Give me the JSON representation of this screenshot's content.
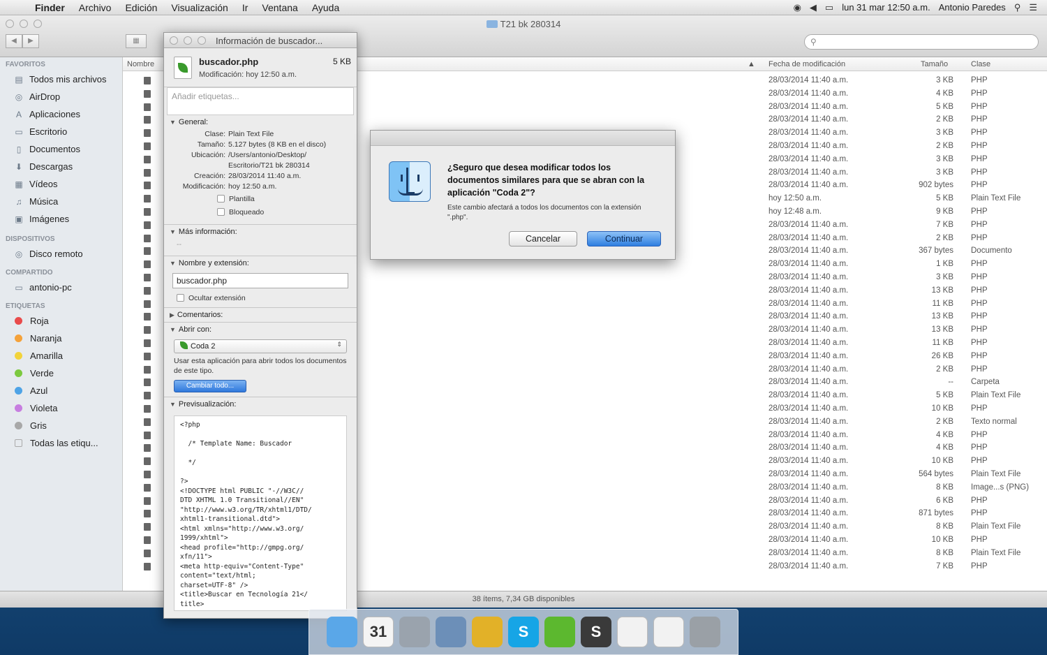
{
  "menubar": {
    "apple": "",
    "menus": [
      "Finder",
      "Archivo",
      "Edición",
      "Visualización",
      "Ir",
      "Ventana",
      "Ayuda"
    ],
    "datetime": "lun 31 mar  12:50 a.m.",
    "user": "Antonio Paredes"
  },
  "window": {
    "title": "T21 bk 280314",
    "search_placeholder": ""
  },
  "sidebar": {
    "favorites_title": "FAVORITOS",
    "favorites": [
      "Todos mis archivos",
      "AirDrop",
      "Aplicaciones",
      "Escritorio",
      "Documentos",
      "Descargas",
      "Vídeos",
      "Música",
      "Imágenes"
    ],
    "devices_title": "DISPOSITIVOS",
    "devices": [
      "Disco remoto"
    ],
    "shared_title": "COMPARTIDO",
    "shared": [
      "antonio-pc"
    ],
    "tags_title": "ETIQUETAS",
    "tags": [
      {
        "label": "Roja",
        "color": "#e94b4b"
      },
      {
        "label": "Naranja",
        "color": "#f5a23a"
      },
      {
        "label": "Amarilla",
        "color": "#f2d33a"
      },
      {
        "label": "Verde",
        "color": "#7cc93f"
      },
      {
        "label": "Azul",
        "color": "#4ea3e6"
      },
      {
        "label": "Violeta",
        "color": "#c77ee0"
      },
      {
        "label": "Gris",
        "color": "#a8a8a8"
      },
      {
        "label": "Todas las etiqu...",
        "color": ""
      }
    ]
  },
  "list": {
    "headers": {
      "name": "Nombre",
      "date": "Fecha de modificación",
      "size": "Tamaño",
      "kind": "Clase"
    },
    "rows": [
      {
        "date": "28/03/2014 11:40 a.m.",
        "size": "3 KB",
        "kind": "PHP"
      },
      {
        "date": "28/03/2014 11:40 a.m.",
        "size": "4 KB",
        "kind": "PHP"
      },
      {
        "date": "28/03/2014 11:40 a.m.",
        "size": "5 KB",
        "kind": "PHP"
      },
      {
        "date": "28/03/2014 11:40 a.m.",
        "size": "2 KB",
        "kind": "PHP"
      },
      {
        "date": "28/03/2014 11:40 a.m.",
        "size": "3 KB",
        "kind": "PHP"
      },
      {
        "date": "28/03/2014 11:40 a.m.",
        "size": "2 KB",
        "kind": "PHP"
      },
      {
        "date": "28/03/2014 11:40 a.m.",
        "size": "3 KB",
        "kind": "PHP"
      },
      {
        "date": "28/03/2014 11:40 a.m.",
        "size": "3 KB",
        "kind": "PHP"
      },
      {
        "date": "28/03/2014 11:40 a.m.",
        "size": "902 bytes",
        "kind": "PHP"
      },
      {
        "date": "hoy 12:50 a.m.",
        "size": "5 KB",
        "kind": "Plain Text File"
      },
      {
        "date": "hoy 12:48 a.m.",
        "size": "9 KB",
        "kind": "PHP"
      },
      {
        "date": "28/03/2014 11:40 a.m.",
        "size": "7 KB",
        "kind": "PHP"
      },
      {
        "date": "28/03/2014 11:40 a.m.",
        "size": "2 KB",
        "kind": "PHP"
      },
      {
        "date": "28/03/2014 11:40 a.m.",
        "size": "367 bytes",
        "kind": "Documento"
      },
      {
        "date": "28/03/2014 11:40 a.m.",
        "size": "1 KB",
        "kind": "PHP"
      },
      {
        "date": "28/03/2014 11:40 a.m.",
        "size": "3 KB",
        "kind": "PHP"
      },
      {
        "date": "28/03/2014 11:40 a.m.",
        "size": "13 KB",
        "kind": "PHP"
      },
      {
        "date": "28/03/2014 11:40 a.m.",
        "size": "11 KB",
        "kind": "PHP"
      },
      {
        "date": "28/03/2014 11:40 a.m.",
        "size": "13 KB",
        "kind": "PHP"
      },
      {
        "date": "28/03/2014 11:40 a.m.",
        "size": "13 KB",
        "kind": "PHP"
      },
      {
        "date": "28/03/2014 11:40 a.m.",
        "size": "11 KB",
        "kind": "PHP"
      },
      {
        "date": "28/03/2014 11:40 a.m.",
        "size": "26 KB",
        "kind": "PHP"
      },
      {
        "date": "28/03/2014 11:40 a.m.",
        "size": "2 KB",
        "kind": "PHP"
      },
      {
        "date": "28/03/2014 11:40 a.m.",
        "size": "--",
        "kind": "Carpeta"
      },
      {
        "date": "28/03/2014 11:40 a.m.",
        "size": "5 KB",
        "kind": "Plain Text File"
      },
      {
        "date": "28/03/2014 11:40 a.m.",
        "size": "10 KB",
        "kind": "PHP"
      },
      {
        "date": "28/03/2014 11:40 a.m.",
        "size": "2 KB",
        "kind": "Texto normal"
      },
      {
        "date": "28/03/2014 11:40 a.m.",
        "size": "4 KB",
        "kind": "PHP"
      },
      {
        "date": "28/03/2014 11:40 a.m.",
        "size": "4 KB",
        "kind": "PHP"
      },
      {
        "date": "28/03/2014 11:40 a.m.",
        "size": "10 KB",
        "kind": "PHP"
      },
      {
        "date": "28/03/2014 11:40 a.m.",
        "size": "564 bytes",
        "kind": "Plain Text File"
      },
      {
        "date": "28/03/2014 11:40 a.m.",
        "size": "8 KB",
        "kind": "Image...s (PNG)"
      },
      {
        "date": "28/03/2014 11:40 a.m.",
        "size": "6 KB",
        "kind": "PHP"
      },
      {
        "date": "28/03/2014 11:40 a.m.",
        "size": "871 bytes",
        "kind": "PHP"
      },
      {
        "date": "28/03/2014 11:40 a.m.",
        "size": "8 KB",
        "kind": "Plain Text File"
      },
      {
        "date": "28/03/2014 11:40 a.m.",
        "size": "10 KB",
        "kind": "PHP"
      },
      {
        "date": "28/03/2014 11:40 a.m.",
        "size": "8 KB",
        "kind": "Plain Text File"
      },
      {
        "date": "28/03/2014 11:40 a.m.",
        "size": "7 KB",
        "kind": "PHP"
      }
    ]
  },
  "status": "38 ítems, 7,34 GB disponibles",
  "info": {
    "title": "Información de buscador...",
    "filename": "buscador.php",
    "size": "5 KB",
    "modified": "Modificación: hoy 12:50 a.m.",
    "tags_placeholder": "Añadir etiquetas...",
    "general_title": "General:",
    "general": [
      {
        "k": "Clase:",
        "v": "Plain Text File"
      },
      {
        "k": "Tamaño:",
        "v": "5.127 bytes (8 KB en el disco)"
      },
      {
        "k": "Ubicación:",
        "v": "/Users/antonio/Desktop/"
      },
      {
        "k": "",
        "v": "Escritorio/T21 bk 280314"
      },
      {
        "k": "Creación:",
        "v": "28/03/2014 11:40 a.m."
      },
      {
        "k": "Modificación:",
        "v": "hoy 12:50 a.m."
      }
    ],
    "template_label": "Plantilla",
    "locked_label": "Bloqueado",
    "more_info_title": "Más información:",
    "more_info_value": "--",
    "name_ext_title": "Nombre y extensión:",
    "name_value": "buscador.php",
    "hide_ext_label": "Ocultar extensión",
    "comments_title": "Comentarios:",
    "open_with_title": "Abrir con:",
    "app": "Coda 2",
    "open_with_help": "Usar esta aplicación para abrir todos los documentos de este tipo.",
    "change_all": "Cambiar todo...",
    "preview_title": "Previsualización:",
    "preview_code": "<?php\n\n  /* Template Name: Buscador\n\n  */\n\n?>\n<!DOCTYPE html PUBLIC \"-//W3C//\nDTD XHTML 1.0 Transitional//EN\"\n\"http://www.w3.org/TR/xhtml1/DTD/\nxhtml1-transitional.dtd\">\n<html xmlns=\"http://www.w3.org/\n1999/xhtml\">\n<head profile=\"http://gmpg.org/\nxfn/11\">\n<meta http-equiv=\"Content-Type\"\ncontent=\"text/html;\ncharset=UTF-8\" />\n<title>Buscar en Tecnología 21</\ntitle>"
  },
  "alert": {
    "message": "¿Seguro que desea modificar todos los documentos similares para que se abran con la aplicación \"Coda 2\"?",
    "info": "Este cambio afectará a todos los documentos con la extensión \".php\".",
    "cancel": "Cancelar",
    "continue": "Continuar"
  },
  "dock": {
    "items": [
      {
        "name": "finder-icon",
        "color": "#5aa7e8",
        "glyph": ""
      },
      {
        "name": "calendar-icon",
        "color": "#f4f4f4",
        "glyph": "31"
      },
      {
        "name": "launchpad-icon",
        "color": "#9aa3ad",
        "glyph": ""
      },
      {
        "name": "preview-icon",
        "color": "#6c8fb8",
        "glyph": ""
      },
      {
        "name": "chrome-icon",
        "color": "#e2b128",
        "glyph": ""
      },
      {
        "name": "skype-icon",
        "color": "#16a5e6",
        "glyph": "S"
      },
      {
        "name": "spotify-icon",
        "color": "#5cb82f",
        "glyph": ""
      },
      {
        "name": "sublime-icon",
        "color": "#3a3a3a",
        "glyph": "S"
      },
      {
        "name": "document-icon",
        "color": "#f2f2f2",
        "glyph": ""
      },
      {
        "name": "document-icon",
        "color": "#f2f2f2",
        "glyph": ""
      },
      {
        "name": "trash-icon",
        "color": "#9aa0a6",
        "glyph": ""
      }
    ]
  }
}
